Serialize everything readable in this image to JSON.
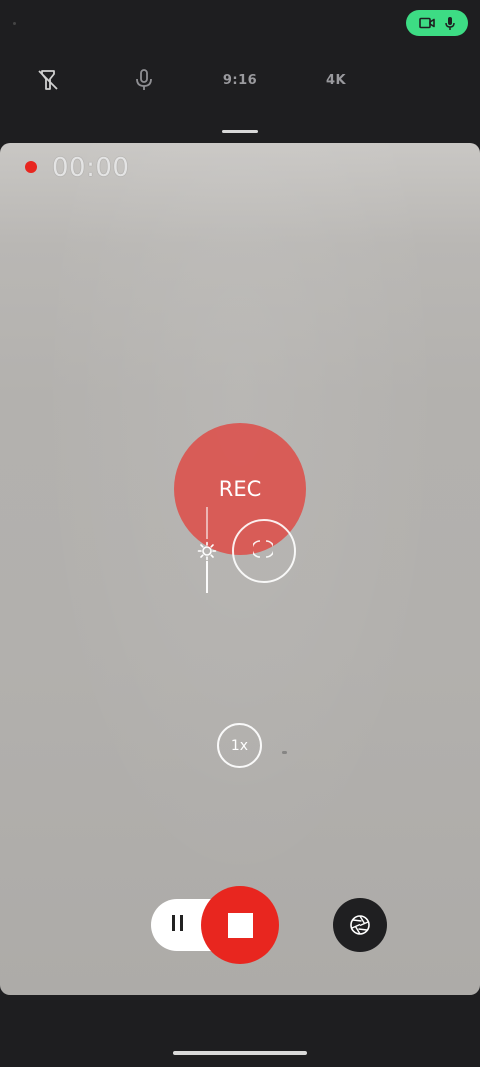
{
  "status": {
    "indicator": {
      "camera_icon": "videocam-icon",
      "mic_icon": "mic-icon",
      "color": "#3ddc84"
    }
  },
  "toolbar": {
    "flash_icon": "flash-off-icon",
    "mic_icon": "mic-icon",
    "aspect_ratio": "9:16",
    "resolution": "4K"
  },
  "viewfinder": {
    "timer": "00:00",
    "recording_dot_color": "#e8261f",
    "rec_label": "REC",
    "zoom": "1x",
    "exposure_icon": "sun-icon"
  },
  "controls": {
    "pause_icon": "pause-icon",
    "stop_icon": "stop-icon",
    "stop_color": "#e8261f",
    "snapshot_icon": "shutter-icon"
  }
}
